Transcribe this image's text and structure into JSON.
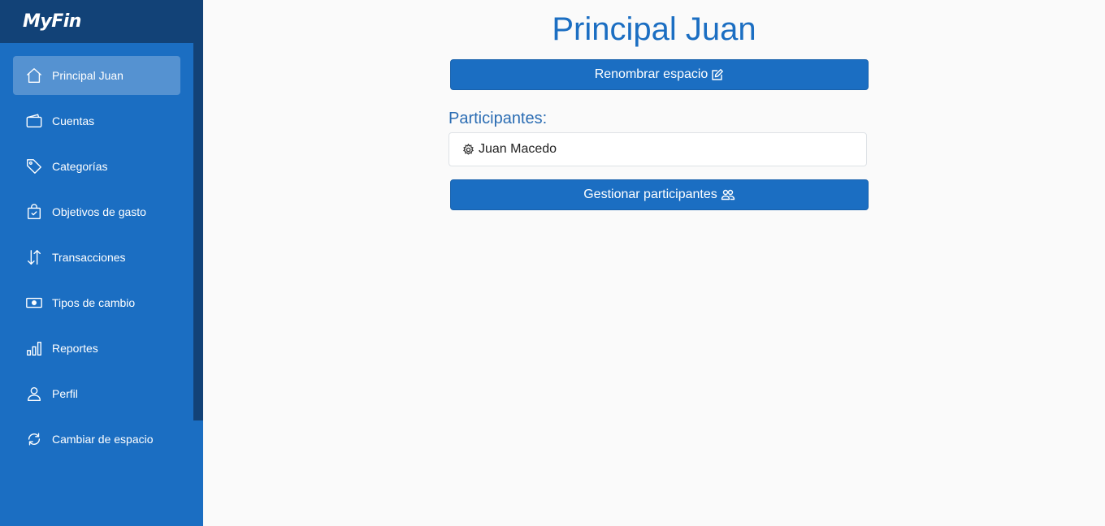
{
  "brand": {
    "name": "MyFin"
  },
  "sidebar": {
    "items": [
      {
        "label": "Principal Juan",
        "icon": "house-icon",
        "active": true
      },
      {
        "label": "Cuentas",
        "icon": "wallet-icon",
        "active": false
      },
      {
        "label": "Categorías",
        "icon": "tag-icon",
        "active": false
      },
      {
        "label": "Objetivos de gasto",
        "icon": "bag-check-icon",
        "active": false
      },
      {
        "label": "Transacciones",
        "icon": "arrow-down-up-icon",
        "active": false
      },
      {
        "label": "Tipos de cambio",
        "icon": "cash-icon",
        "active": false
      },
      {
        "label": "Reportes",
        "icon": "bar-chart-icon",
        "active": false
      },
      {
        "label": "Perfil",
        "icon": "person-icon",
        "active": false
      },
      {
        "label": "Cambiar de espacio",
        "icon": "arrow-repeat-icon",
        "active": false
      }
    ]
  },
  "main": {
    "title": "Principal Juan",
    "rename_button": {
      "label": "Renombrar espacio",
      "icon": "pencil-square-icon"
    },
    "participants_label": "Participantes:",
    "participants": [
      {
        "name": "Juan Macedo",
        "icon": "gear-icon"
      }
    ],
    "manage_button": {
      "label": "Gestionar participantes",
      "icon": "people-icon"
    }
  },
  "colors": {
    "primary": "#1b6ec2",
    "sidebar_dark": "#124277",
    "active_item": "#5592d1",
    "background": "#fafafa"
  }
}
